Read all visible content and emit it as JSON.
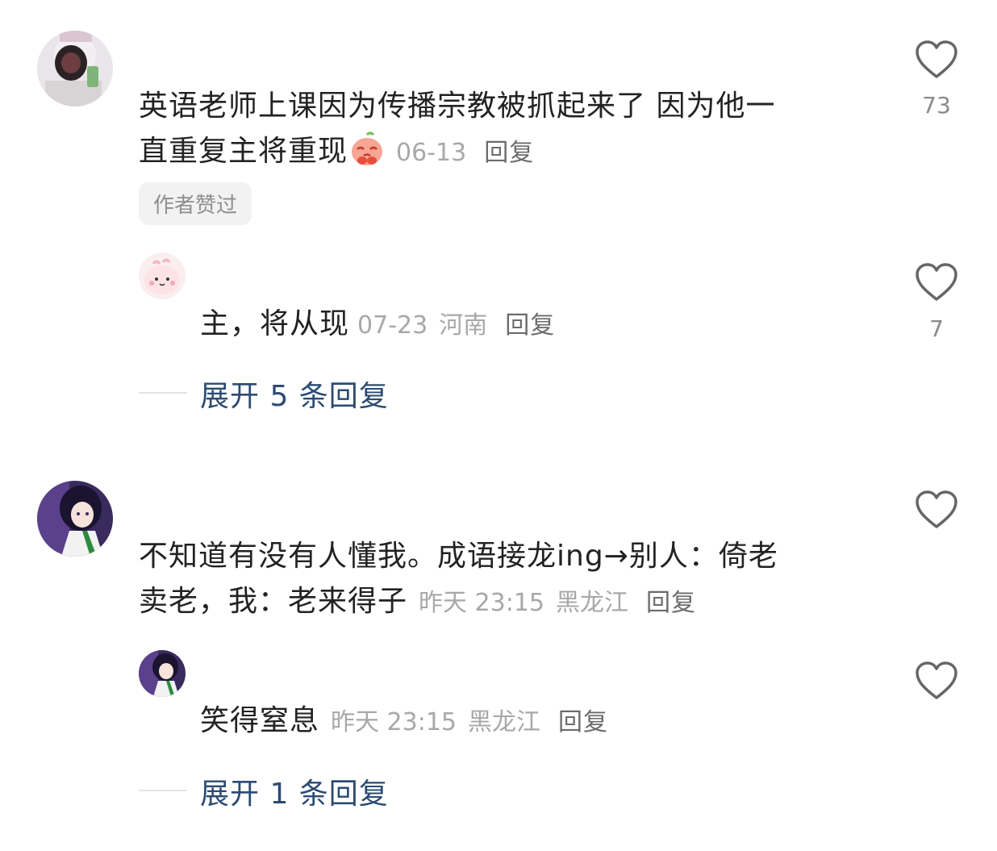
{
  "comments": [
    {
      "text": "英语老师上课因为传播宗教被抓起来了 因为他一直重复主将重现",
      "text_line1": "英语老师上课因为传播宗教被抓起来了 因为他一",
      "text_line2": "直重复主将重现",
      "date": "06-13",
      "reply_label": "回复",
      "badge": "作者赞过",
      "likes": "73",
      "reply": {
        "text": "主，将从现",
        "date": "07-23",
        "location": "河南",
        "reply_label": "回复",
        "likes": "7"
      },
      "expand_label": "展开 5 条回复"
    },
    {
      "text_line1": "不知道有没有人懂我。成语接龙ing→别人：倚老",
      "text_line2": "卖老，我：老来得子",
      "date": "昨天 23:15",
      "location": "黑龙江",
      "reply_label": "回复",
      "reply": {
        "text": "笑得窒息",
        "date": "昨天 23:15",
        "location": "黑龙江",
        "reply_label": "回复"
      },
      "expand_label": "展开 1 条回复"
    }
  ]
}
